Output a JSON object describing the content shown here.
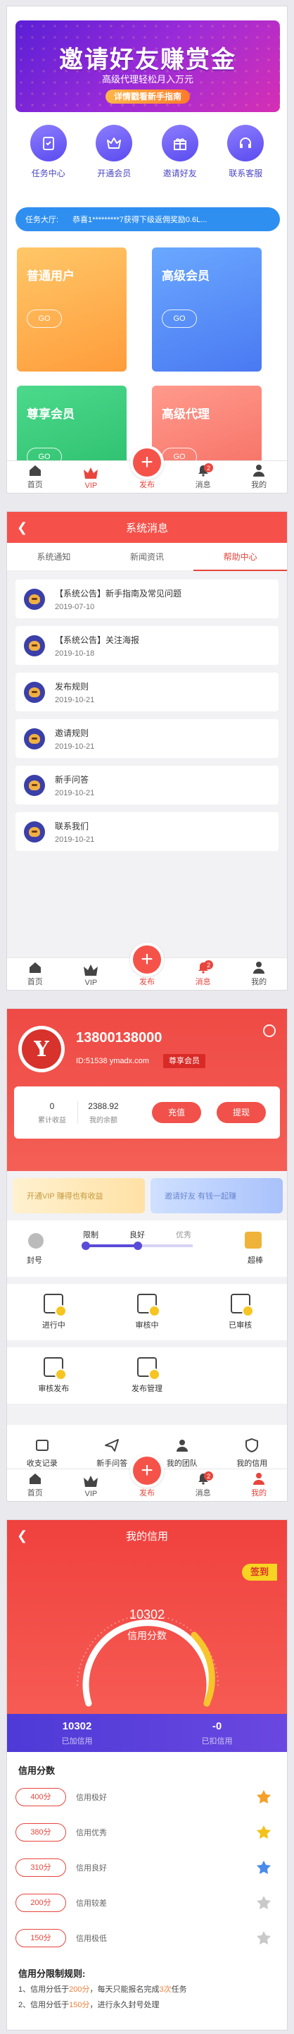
{
  "tabbar": {
    "items": [
      {
        "label": "首页",
        "icon": "home-icon"
      },
      {
        "label": "VIP",
        "icon": "crown-icon"
      },
      {
        "label": "发布",
        "icon": "plus-icon"
      },
      {
        "label": "消息",
        "icon": "bell-icon",
        "badge": "2"
      },
      {
        "label": "我的",
        "icon": "user-icon"
      }
    ]
  },
  "home": {
    "banner": {
      "title": "邀请好友赚赏金",
      "subtitle": "高级代理轻松月入万元",
      "button": "详情戳看新手指南"
    },
    "quick": [
      {
        "label": "任务中心",
        "icon": "clipboard-icon"
      },
      {
        "label": "开通会员",
        "icon": "crown-icon"
      },
      {
        "label": "邀请好友",
        "icon": "gift-icon"
      },
      {
        "label": "联系客服",
        "icon": "headset-icon"
      }
    ],
    "notice": {
      "label": "任务大厅:",
      "text": "恭喜1*********7获得下级返佣奖励0.6L..."
    },
    "cards": [
      {
        "title": "普通用户",
        "button": "GO"
      },
      {
        "title": "高级会员",
        "button": "GO"
      },
      {
        "title": "尊享会员",
        "button": "GO"
      },
      {
        "title": "高级代理",
        "button": "GO"
      }
    ]
  },
  "messages": {
    "title": "系统消息",
    "tabs": [
      "系统通知",
      "新闻资讯",
      "帮助中心"
    ],
    "active_tab": 2,
    "items": [
      {
        "title": "【系统公告】新手指南及常见问题",
        "date": "2019-07-10"
      },
      {
        "title": "【系统公告】关注海报",
        "date": "2019-10-18"
      },
      {
        "title": "发布规则",
        "date": "2019-10-21"
      },
      {
        "title": "邀请规则",
        "date": "2019-10-21"
      },
      {
        "title": "新手问答",
        "date": "2019-10-21"
      },
      {
        "title": "联系我们",
        "date": "2019-10-21"
      }
    ]
  },
  "profile": {
    "phone": "13800138000",
    "id_text": "ID:51538 ymadx.com",
    "vip_tag": "尊享会员",
    "wallet": [
      {
        "value": "0",
        "label": "累计收益"
      },
      {
        "value": "2388.92",
        "label": "我的余额"
      }
    ],
    "recharge": "充值",
    "withdraw": "提现",
    "promos": [
      "开通VIP 赚得也有收益",
      "邀请好友 有钱一起赚"
    ],
    "credit_left": "封号",
    "credit_levels": [
      "限制",
      "良好",
      "优秀"
    ],
    "credit_right": "超棒",
    "credit_level_fraction": 0.5,
    "grid_row1": [
      {
        "label": "进行中",
        "icon": "task-running-icon"
      },
      {
        "label": "审核中",
        "icon": "task-review-icon"
      },
      {
        "label": "已审核",
        "icon": "task-done-icon"
      }
    ],
    "grid_row2": [
      {
        "label": "审核发布",
        "icon": "review-publish-icon"
      },
      {
        "label": "发布管理",
        "icon": "publish-manage-icon"
      }
    ],
    "grid_row3": [
      {
        "label": "收支记录",
        "icon": "wallet-record-icon"
      },
      {
        "label": "新手问答",
        "icon": "paper-plane-icon"
      },
      {
        "label": "我的团队",
        "icon": "team-icon"
      },
      {
        "label": "我的信用",
        "icon": "shield-icon"
      }
    ]
  },
  "credit": {
    "title": "我的信用",
    "sign": "签到",
    "score": "10302",
    "score_label": "信用分数",
    "stats": [
      {
        "value": "10302",
        "label": "已加信用"
      },
      {
        "value": "-0",
        "label": "已扣信用"
      }
    ],
    "section_title": "信用分数",
    "levels": [
      {
        "points": "400分",
        "text": "信用极好",
        "medal_color": "#f5a028"
      },
      {
        "points": "380分",
        "text": "信用优秀",
        "medal_color": "#f3c21b"
      },
      {
        "points": "310分",
        "text": "信用良好",
        "medal_color": "#4a8bea"
      },
      {
        "points": "200分",
        "text": "信用较差",
        "medal_color": "#c9c9c9"
      },
      {
        "points": "150分",
        "text": "信用极低",
        "medal_color": "#c9c9c9"
      }
    ],
    "rules_title": "信用分限制规则:",
    "rules": [
      {
        "prefix": "1、信用分低于",
        "value": "200分",
        "suffix": "，每天只能报名完成",
        "value2": "3次",
        "end": "任务"
      },
      {
        "prefix": "2、信用分低于",
        "value": "150分",
        "suffix": "，进行永久封号处理",
        "value2": "",
        "end": ""
      }
    ]
  },
  "colors": {
    "accent_red": "#f5514a",
    "purple": "#5a4bd8",
    "blue_notice": "#2f8ff0"
  }
}
